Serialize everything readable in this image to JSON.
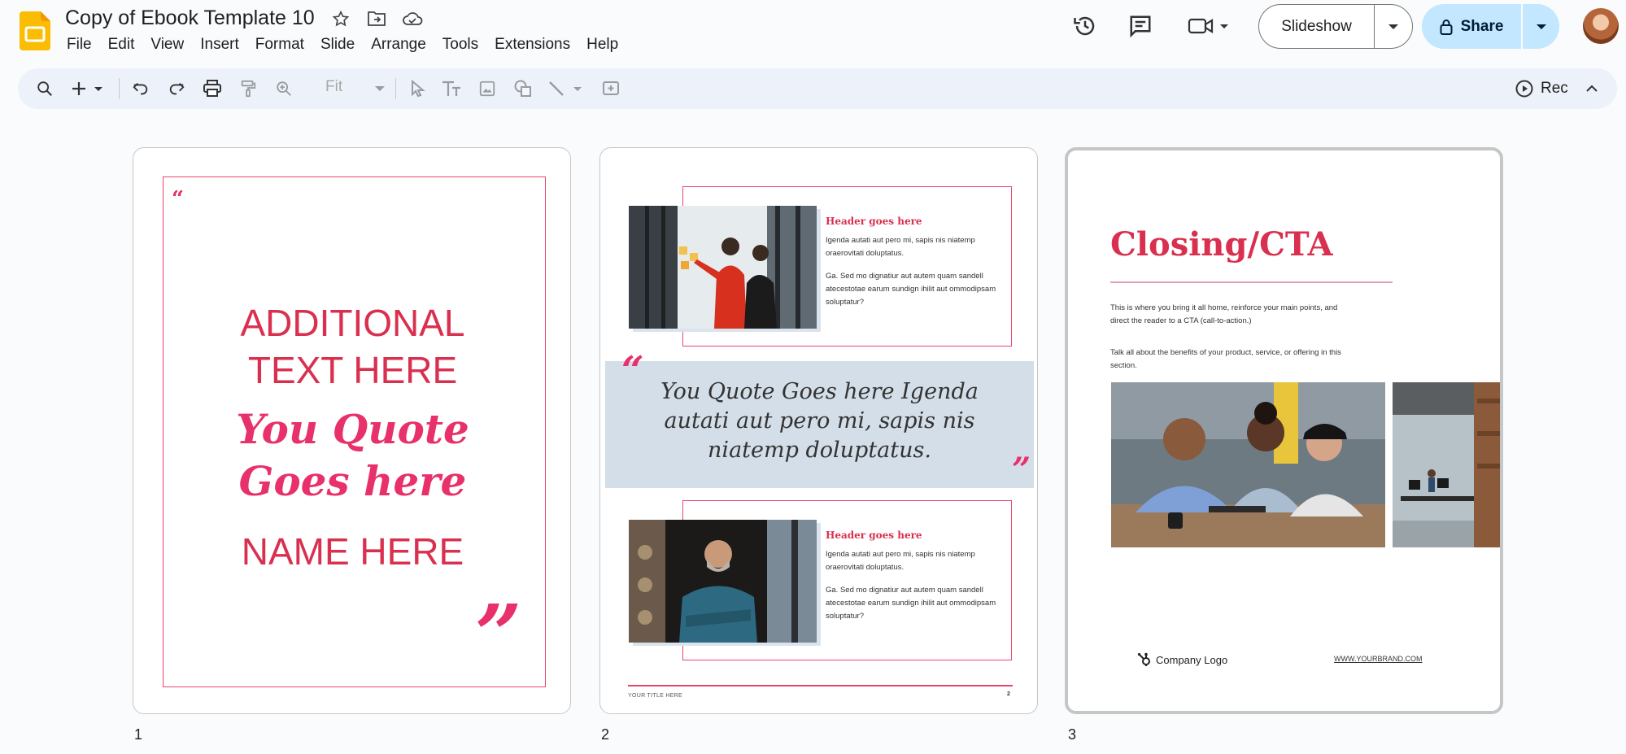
{
  "app": {
    "doc_title": "Copy of Ebook Template 10",
    "menu": [
      "File",
      "Edit",
      "View",
      "Insert",
      "Format",
      "Slide",
      "Arrange",
      "Tools",
      "Extensions",
      "Help"
    ],
    "slideshow_label": "Slideshow",
    "share_label": "Share",
    "brand_color": "#fbbc04"
  },
  "toolbar": {
    "zoom_label": "Fit",
    "rec_label": "Rec"
  },
  "slides": [
    {
      "number": "1",
      "quote_open": "“",
      "additional_text": "ADDITIONAL TEXT HERE",
      "quote": "You Quote Goes here",
      "name": "NAME HERE",
      "quote_close": "”"
    },
    {
      "number": "2",
      "card1": {
        "header": "Header goes here",
        "p1": "Igenda autati aut pero mi, sapis nis niatemp oraerovitati doluptatus.",
        "p2": "Ga. Sed mo dignatiur aut autem quam sandell atecestotae earum sundign ihilit aut ommodipsam soluptatur?"
      },
      "quote_open": "“",
      "quote": "You Quote Goes here Igenda autati aut pero mi, sapis nis niatemp doluptatus.",
      "quote_close": "”",
      "card2": {
        "header": "Header goes here",
        "p1": "Igenda autati aut pero mi, sapis nis niatemp oraerovitati doluptatus.",
        "p2": "Ga. Sed mo dignatiur aut autem quam sandell atecestotae earum sundign ihilit aut ommodipsam soluptatur?"
      },
      "footer_title": "YOUR TITLE HERE",
      "page_number": "2"
    },
    {
      "number": "3",
      "title": "Closing/CTA",
      "p1": "This is where you bring it all home, reinforce your main points, and direct the reader to a CTA (call-to-action.)",
      "p2": "Talk all about the benefits of your product, service, or offering in this section.",
      "logo_text": "Company Logo",
      "url": "WWW.YOURBRAND.COM"
    }
  ]
}
